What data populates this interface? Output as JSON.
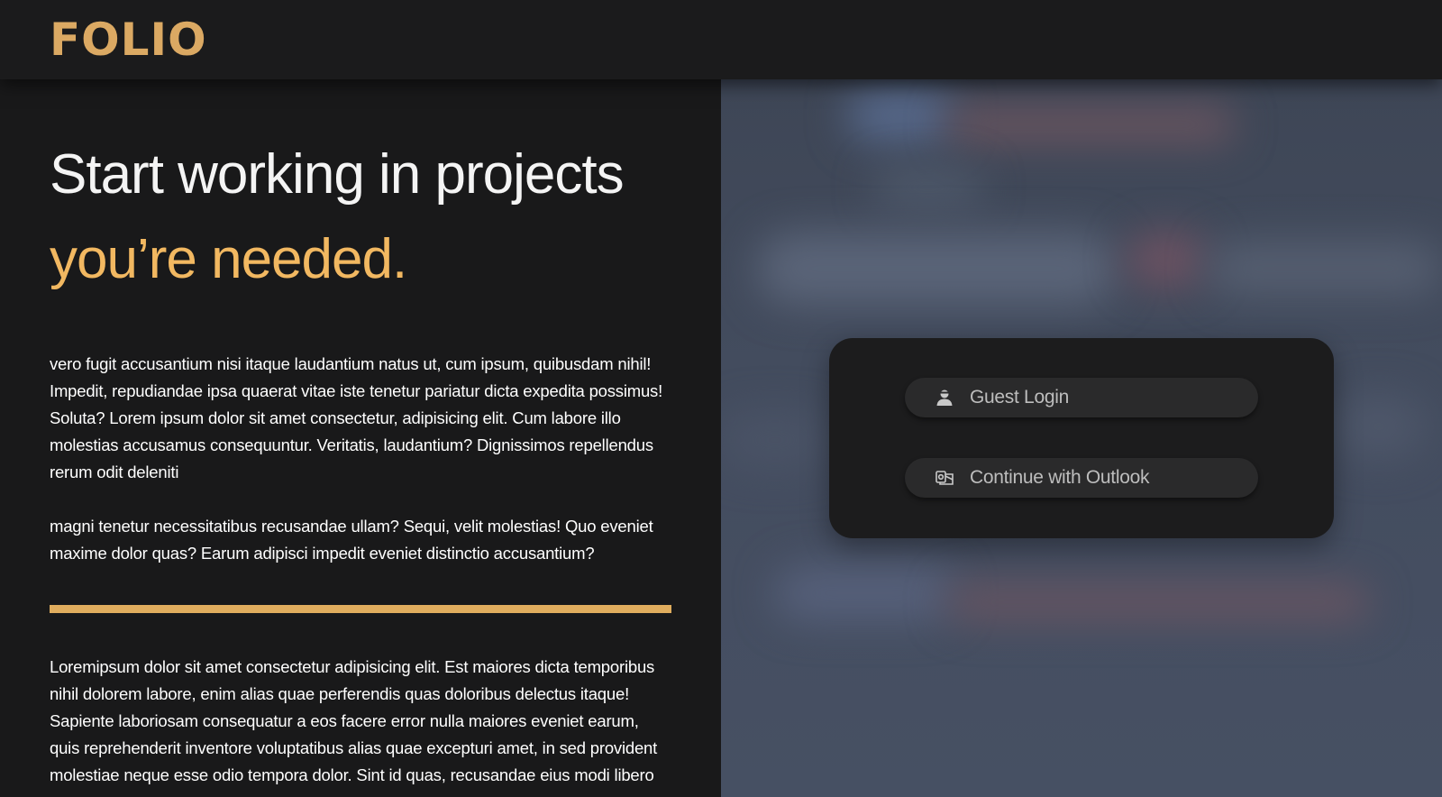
{
  "brand": {
    "logo": "FOLIO",
    "accent_color": "#dba963"
  },
  "hero": {
    "headline_line1": "Start working in projects",
    "headline_line2": "you’re needed.",
    "headline_accent_color": "#f2b861"
  },
  "content": {
    "paragraph1": "vero fugit accusantium nisi itaque laudantium natus ut, cum ipsum, quibusdam nihil! Impedit, repudiandae ipsa quaerat vitae iste tenetur pariatur dicta expedita possimus! Soluta? Lorem ipsum dolor sit amet consectetur, adipisicing elit. Cum labore illo molestias accusamus consequuntur. Veritatis, laudantium? Dignissimos repellendus rerum odit deleniti",
    "paragraph2": "magni tenetur necessitatibus recusandae ullam? Sequi, velit molestias! Quo eveniet maxime dolor quas? Earum adipisci impedit eveniet distinctio accusantium?",
    "paragraph3": "Loremipsum dolor sit amet consectetur adipisicing elit. Est maiores dicta temporibus nihil dolorem labore, enim alias quae perferendis quas doloribus delectus itaque! Sapiente laboriosam consequatur a eos facere error nulla maiores eveniet earum, quis reprehenderit inventore voluptatibus alias quae excepturi amet, in sed provident molestiae neque esse odio tempora dolor. Sint id quas, recusandae eius modi libero"
  },
  "login": {
    "guest_label": "Guest Login",
    "guest_icon": "user-icon",
    "outlook_label": "Continue with Outlook",
    "outlook_icon": "outlook-icon"
  }
}
